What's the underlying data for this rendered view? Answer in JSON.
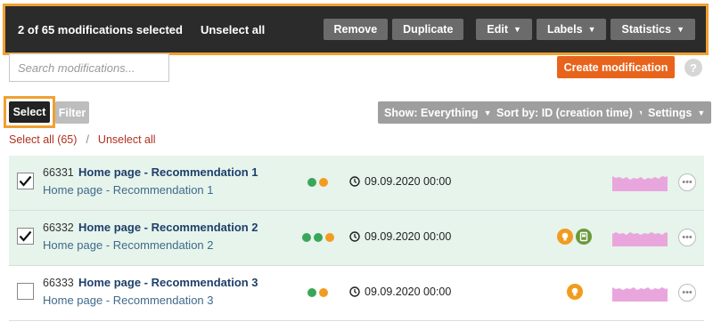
{
  "selection_bar": {
    "count_text": "2 of 65 modifications selected",
    "unselect_all": "Unselect all",
    "remove": "Remove",
    "duplicate": "Duplicate",
    "edit": "Edit",
    "labels": "Labels",
    "statistics": "Statistics",
    "highlight_color": "#f0a030"
  },
  "search": {
    "placeholder": "Search modifications...",
    "value": ""
  },
  "create_button": "Create modification",
  "help": "?",
  "toolbar": {
    "select": "Select",
    "filter": "Filter",
    "show": "Show: Everything",
    "sort": "Sort by: ID (creation time)",
    "settings": "Settings"
  },
  "select_links": {
    "select_all": "Select all (65)",
    "separator": "/",
    "unselect_all": "Unselect all"
  },
  "colors": {
    "accent": "#e8641c",
    "green": "#3aa65a",
    "orange": "#f29c1f",
    "selected_row": "#e6f4ec",
    "link_red": "#b03020"
  },
  "rows": [
    {
      "id": "66331",
      "name": "Home page - Recommendation 1",
      "subtitle": "Home page - Recommendation 1",
      "checked": true,
      "status_dots": [
        "green",
        "orange"
      ],
      "date": "09.09.2020 00:00",
      "badges": []
    },
    {
      "id": "66332",
      "name": "Home page - Recommendation 2",
      "subtitle": "Home page - Recommendation 2",
      "checked": true,
      "status_dots": [
        "green",
        "green",
        "orange"
      ],
      "date": "09.09.2020 00:00",
      "badges": [
        "orange-lightbulb-icon",
        "green-device-icon"
      ]
    },
    {
      "id": "66333",
      "name": "Home page - Recommendation 3",
      "subtitle": "Home page - Recommendation 3",
      "checked": false,
      "status_dots": [
        "green",
        "orange"
      ],
      "date": "09.09.2020 00:00",
      "badges": [
        "orange-lightbulb-icon"
      ]
    }
  ]
}
